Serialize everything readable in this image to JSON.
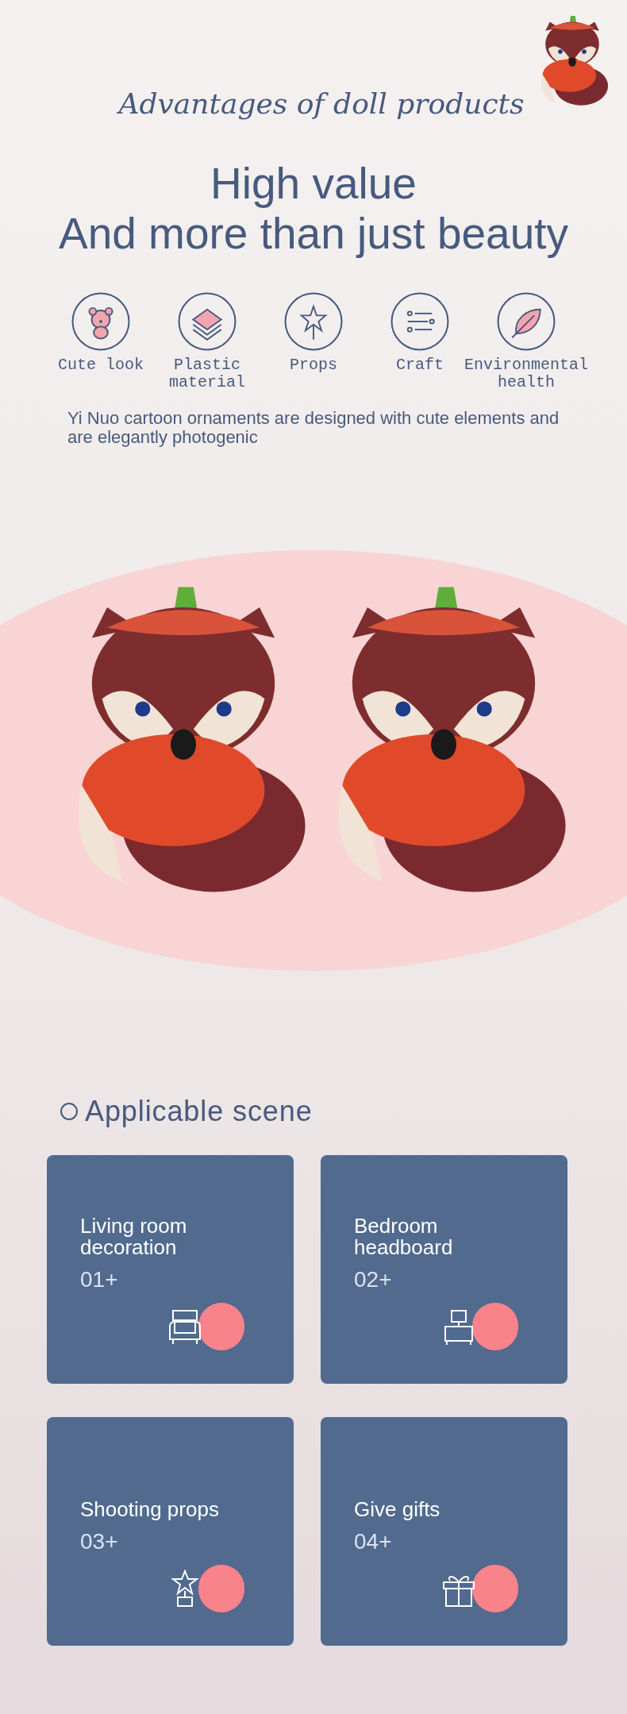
{
  "heading": "Advantages of doll products",
  "headline": [
    "High value",
    "And more than just beauty"
  ],
  "features": [
    {
      "label": "Cute look",
      "kind": "bear"
    },
    {
      "label": "Plastic material",
      "kind": "layers"
    },
    {
      "label": "Props",
      "kind": "wand"
    },
    {
      "label": "Craft",
      "kind": "list"
    },
    {
      "label": "Environmental health",
      "kind": "leaf"
    }
  ],
  "description": "Yi Nuo cartoon ornaments are designed with cute elements and are elegantly photogenic",
  "scene": {
    "title": "Applicable scene",
    "cards": [
      {
        "title": "Living room decoration",
        "number": "01+",
        "kind": "sofa"
      },
      {
        "title": "Bedroom headboard",
        "number": "02+",
        "kind": "nightstand"
      },
      {
        "title": "Shooting props",
        "number": "03+",
        "kind": "trophy"
      },
      {
        "title": "Give gifts",
        "number": "04+",
        "kind": "gift"
      }
    ]
  }
}
